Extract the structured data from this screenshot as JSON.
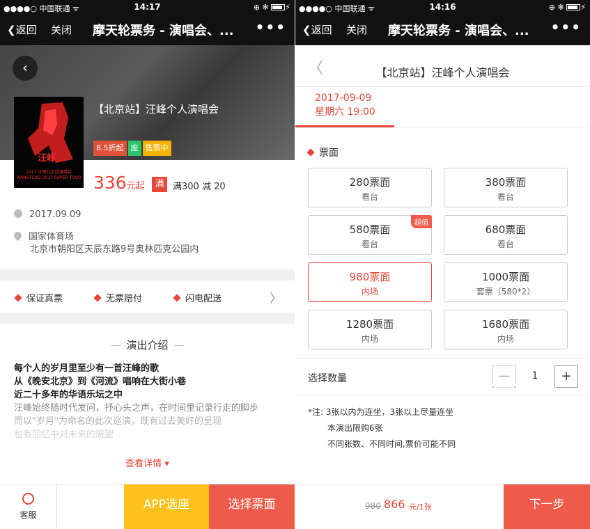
{
  "left": {
    "status": {
      "carrier": "●●●●○ 中国联通 ᯤ",
      "time": "14:17",
      "right": "⊕ ✻"
    },
    "nav": {
      "back": "❮返回",
      "close": "关闭",
      "title": "摩天轮票务 - 演唱会、...",
      "more": "•••"
    },
    "back_glyph": "‹",
    "poster": {
      "title": "汪峰",
      "subtitle": "2017 汪峰北京站演唱会\nWANGFENG 2017 SUPER TOUR"
    },
    "event_title": "【北京站】汪峰个人演唱会",
    "tags": [
      "8.5折起",
      "座",
      "售票中"
    ],
    "price": {
      "value": "336",
      "unit": "元起"
    },
    "promo_badge": "满",
    "promo_text": "满300 减 20",
    "date": "2017.09.09",
    "venue": "国家体育场",
    "address": "北京市朝阳区天辰东路9号奥林匹克公园内",
    "guarantees": [
      "保证真票",
      "无票赔付",
      "闪电配送"
    ],
    "chevron": "〉",
    "section_title": "演出介绍",
    "intro": [
      "每个人的岁月里至少有一首汪峰的歌",
      "从《晚安北京》到《河流》唱响在大街小巷",
      "近二十多年的华语乐坛之中",
      "汪峰始终随时代发问，抒心头之声，在时间里记录行走的脚步",
      "而以\"岁月\"为命名的此次巡演，既有过去美好的呈现",
      "也有回忆中对未来的展望"
    ],
    "more": "查看详情 ▾",
    "bottom": {
      "service": "客服",
      "app": "APP选座",
      "select": "选择票面"
    }
  },
  "right": {
    "status": {
      "carrier": "●●●●○ 中国联通 ᯤ",
      "time": "14:16",
      "right": "⊕ ✻"
    },
    "nav": {
      "back": "❮返回",
      "close": "关闭",
      "title": "摩天轮票务 - 演唱会、...",
      "more": "•••"
    },
    "header_back": "〈",
    "header_title": "【北京站】汪峰个人演唱会",
    "date_tab": {
      "date": "2017-09-09",
      "time": "星期六 19:00"
    },
    "ticket_label": "票面",
    "tickets": [
      {
        "price": "280票面",
        "area": "看台"
      },
      {
        "price": "380票面",
        "area": "看台"
      },
      {
        "price": "580票面",
        "area": "看台",
        "badge": "超值"
      },
      {
        "price": "680票面",
        "area": "看台"
      },
      {
        "price": "980票面",
        "area": "内场",
        "selected": true
      },
      {
        "price": "1000票面",
        "area": "套票（580*2）"
      },
      {
        "price": "1280票面",
        "area": "内场"
      },
      {
        "price": "1680票面",
        "area": "内场"
      }
    ],
    "qty": {
      "label": "选择数量",
      "minus": "—",
      "value": "1",
      "plus": "+"
    },
    "notes": [
      "*注: 3张以内为连坐，3张以上尽量连坐",
      "本演出限购6张",
      "不同张数、不同时间,票价可能不同"
    ],
    "bottom": {
      "old_price": "980",
      "new_price": "866",
      "unit": "元/1张",
      "next": "下一步"
    }
  }
}
